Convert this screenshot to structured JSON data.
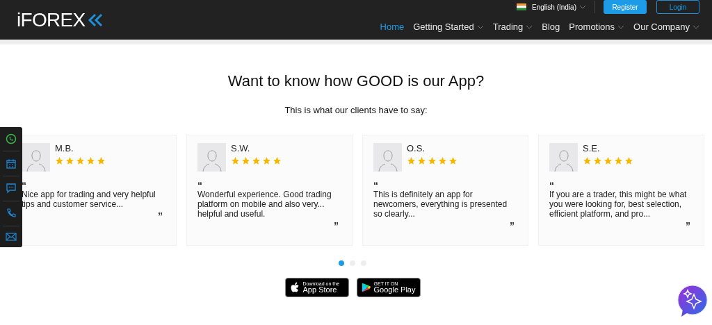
{
  "header": {
    "logo": "iFOREX",
    "language": "English (India)",
    "register": "Register",
    "login": "Login",
    "nav": [
      {
        "label": "Home",
        "selected": true,
        "dropdown": false
      },
      {
        "label": "Getting Started",
        "selected": false,
        "dropdown": true
      },
      {
        "label": "Trading",
        "selected": false,
        "dropdown": true
      },
      {
        "label": "Blog",
        "selected": false,
        "dropdown": false
      },
      {
        "label": "Promotions",
        "selected": false,
        "dropdown": true
      },
      {
        "label": "Our Company",
        "selected": false,
        "dropdown": true
      }
    ]
  },
  "title": "Want to know how GOOD is our App?",
  "subtitle": "This is what our clients have to say:",
  "side_toolbar": [
    {
      "kind": "whatsapp"
    },
    {
      "kind": "calendar"
    },
    {
      "kind": "chat"
    },
    {
      "kind": "phone"
    },
    {
      "kind": "mail"
    }
  ],
  "reviews": [
    {
      "name": "M.B.",
      "stars": 5,
      "open_quote": "“",
      "text": "Nice app for trading and very helpful tips and customer service...",
      "close_quote": "”"
    },
    {
      "name": "S.W.",
      "stars": 5,
      "open_quote": "“",
      "text": "Wonderful experience. Good trading platform on mobile and also very... helpful and useful.",
      "close_quote": "”"
    },
    {
      "name": "O.S.",
      "stars": 5,
      "open_quote": "“",
      "text": "This is definitely an app for newcomers, everything is presented so clearly...",
      "close_quote": "”"
    },
    {
      "name": "S.E.",
      "stars": 5,
      "open_quote": "“",
      "text": "If you are a trader, this might be what you were looking for, best selection, efficient platform, and pro...",
      "close_quote": "”"
    }
  ],
  "pagination": [
    {
      "selected": true
    },
    {
      "selected": false
    },
    {
      "selected": false
    }
  ],
  "stores": [
    {
      "kind": "apple",
      "small": "Download on the",
      "big": "App Store"
    },
    {
      "kind": "google",
      "small": "GET IT ON",
      "big": "Google Play"
    }
  ]
}
